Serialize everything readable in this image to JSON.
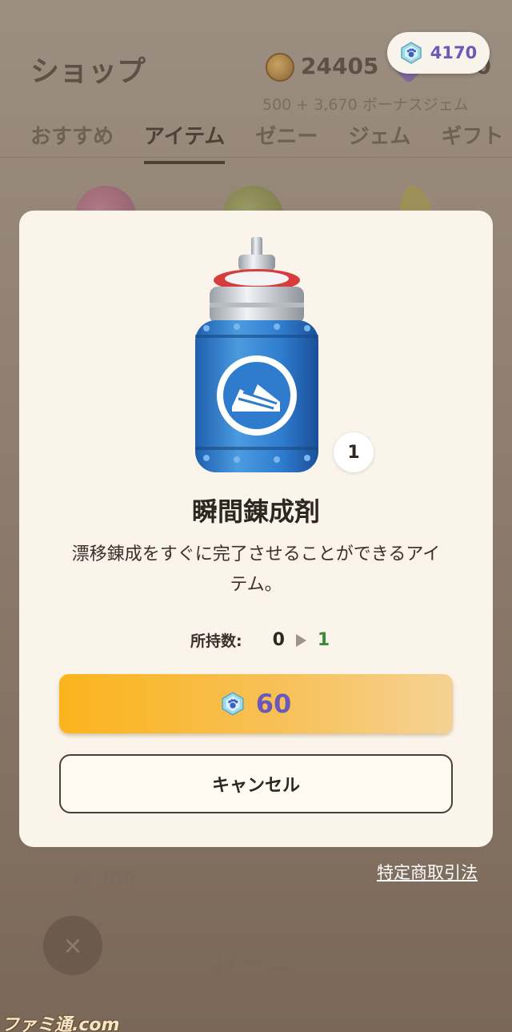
{
  "header": {
    "title": "ショップ",
    "zenny_amount": "24405",
    "gem_amount_partial": "1170",
    "bonus_text": "500 + 3,670 ボーナスジェム",
    "gem_pill_amount": "4170"
  },
  "tabs": [
    {
      "label": "おすすめ",
      "active": false
    },
    {
      "label": "アイテム",
      "active": true
    },
    {
      "label": "ゼニー",
      "active": false
    },
    {
      "label": "ジェム",
      "active": false
    },
    {
      "label": "ギフト",
      "active": false
    }
  ],
  "background": {
    "price_label": "300",
    "section_heading": "ゼニー",
    "close_glyph": "×",
    "watermark": "ファミ通.com"
  },
  "modal": {
    "quantity_badge": "1",
    "item_name": "瞬間錬成剤",
    "item_description": "漂移錬成をすぐに完了させることができるアイテム。",
    "owned_label": "所持数:",
    "owned_from": "0",
    "owned_to": "1",
    "buy_price": "60",
    "cancel_label": "キャンセル"
  },
  "legal_link": "特定商取引法",
  "colors": {
    "accent_purple": "#6b58b8",
    "buy_gradient_start": "#fbb41c",
    "owned_to_green": "#3a8a3a",
    "modal_bg": "#faf4ea"
  },
  "icons": {
    "currency_zenny": "coin-icon",
    "currency_gem": "gem-icon",
    "arrow": "triangle-right-icon",
    "close": "close-icon"
  }
}
